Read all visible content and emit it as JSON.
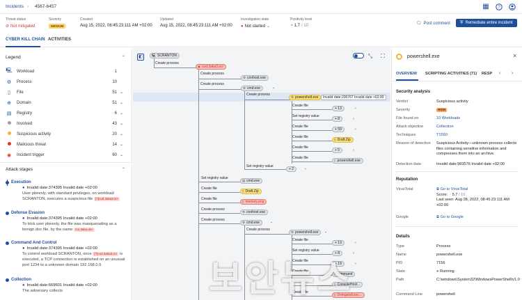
{
  "breadcrumb": {
    "root": "Incidents",
    "id": "4567-6457"
  },
  "header": {
    "threat_status_label": "Threat status",
    "threat_status": "Not mitigated",
    "severity_label": "Severity",
    "severity": "MEDIUM",
    "created_label": "Created",
    "created": "Aug 15, 2022, 06:45:23:111 AM +02:00",
    "updated_label": "Updated",
    "updated": "Aug 15, 2022, 08:45:23:111 AM +02:00",
    "investigation_label": "Investigation state",
    "investigation": "Not started",
    "positivity_label": "Positivity level",
    "positivity": "1.7",
    "positivity_max": "/ 10",
    "post_comment": "Post comment",
    "remediate": "Remediate entire incident"
  },
  "tabs": [
    "CYBER KILL CHAIN",
    "ACTIVITIES"
  ],
  "legend": {
    "title": "Legend",
    "items": [
      {
        "label": "Workload",
        "count": "1"
      },
      {
        "label": "Process",
        "count": "10"
      },
      {
        "label": "File",
        "count": "51"
      },
      {
        "label": "Domain",
        "count": "51"
      },
      {
        "label": "Registry",
        "count": "6"
      },
      {
        "label": "Involved",
        "count": "43"
      },
      {
        "label": "Suspicious activity",
        "count": "20"
      },
      {
        "label": "Malicious threat",
        "count": "14"
      },
      {
        "label": "Incident trigger",
        "count": "60"
      }
    ],
    "colors": {
      "involved": "#9aa0a8",
      "suspicious": "#f2b632",
      "malicious": "#d4382d",
      "trigger": "#d4382d"
    }
  },
  "attack_stages": {
    "title": "Attack stages",
    "items": [
      {
        "name": "Execution",
        "date": "Invalid date:374395 Invalid date +02:00",
        "desc1": "User pbeesly, with standard privileges, on workload SCRANTON, executes a suspicious file",
        "chip": "[?]cod.3aka3.scr"
      },
      {
        "name": "Defense Evasion",
        "date": "Invalid date:374395 Invalid date +02:00",
        "desc1": "To trick user pbeesly, the file was masquerading as a benign doc file, by the name",
        "chip": "rcs.3aka.doc"
      },
      {
        "name": "Command And Control",
        "date": "Invalid date:374395 Invalid date +02:00",
        "desc1": "To control workload SCRANTON, once",
        "chip": "[?]cod.3aka3.scr",
        "desc2": "is executed, a TCP connection is established on an unusual port 1234 to a unknown domain 192.168.0.5"
      },
      {
        "name": "Collection",
        "date": "Invalid date:669601 Invalid date +02:00",
        "desc1": "The adversary collects"
      }
    ]
  },
  "graph": {
    "nodes": {
      "scranton": "SCRANTON",
      "cod": "cod.3aka3.scr",
      "conhost1": "conhost.exe",
      "cmd1": "cmd.exe",
      "powershell1": "powershell.exe",
      "tooltip": "Invalid date:206767 Invalid date +02:00",
      "c13a": "+ 13",
      "c8a": "+ 8",
      "c59": "+ 59",
      "draft1": "Draft.Zip",
      "c5": "+ 5",
      "ps_small": "powershell.exe",
      "c2": "+ 2",
      "cmd2": "cmd.exe",
      "draft2": "Draft.Zip",
      "monkey": "monkey.png",
      "conhost2": "conhost.exe",
      "cmd3": "cmd.exe",
      "powershell2": "powershell.exe",
      "c13b": "+ 13",
      "c8b": "+ 8",
      "c19": "+ 19",
      "command": "command",
      "consolehost": "ConsoleHost...",
      "delegate": "DelegateExec..."
    },
    "labels": {
      "create_process": "Create process",
      "create_file": "Create file",
      "set_registry": "Set registry value"
    }
  },
  "details": {
    "title": "powershell.exe",
    "tabs": [
      "OVERVIEW",
      "SCRIPTING ACTIVITIES (71)",
      "RESP"
    ],
    "security_analysis": "Security analysis",
    "verdict_k": "Verdict",
    "verdict": "Suspicious activity",
    "severity_k": "Severity",
    "severity": "HIGH",
    "file_found_k": "File found on",
    "file_found": "10 Workloads",
    "objective_k": "Attack objective",
    "objective": "Collection",
    "techniques_k": "Techniques",
    "techniques": "T1560",
    "reason_k": "Reason of detection",
    "reason": "Suspicious Activity—unknown process collects files containing sensitive information and compresses them into an archive.",
    "detection_k": "Detection date",
    "detection": "Invalid date:983576 Invalid date +02:00",
    "reputation": "Reputation",
    "virustotal_k": "VirusTotal",
    "virustotal_link": "Go to VirusTotal",
    "score_label": "Score:",
    "score": "5.7",
    "score_max": "/ 10",
    "last_seen": "Last seen: Aug 28, 2022, 08:45:23:111 AM +02:00",
    "google_k": "Google",
    "google_link": "Go to Google",
    "details_title": "Details",
    "type_k": "Type",
    "type": "Process",
    "name_k": "Name",
    "name": "powershell.exe",
    "pid_k": "PID",
    "pid": "7156",
    "state_k": "State",
    "state": "Running",
    "path_k": "Path",
    "path": "C:\\windows\\System32\\WindowsPowerShell\\v1.0",
    "cmd_k": "Command Line",
    "cmd": "powershell"
  },
  "watermark": "보안뉴스"
}
